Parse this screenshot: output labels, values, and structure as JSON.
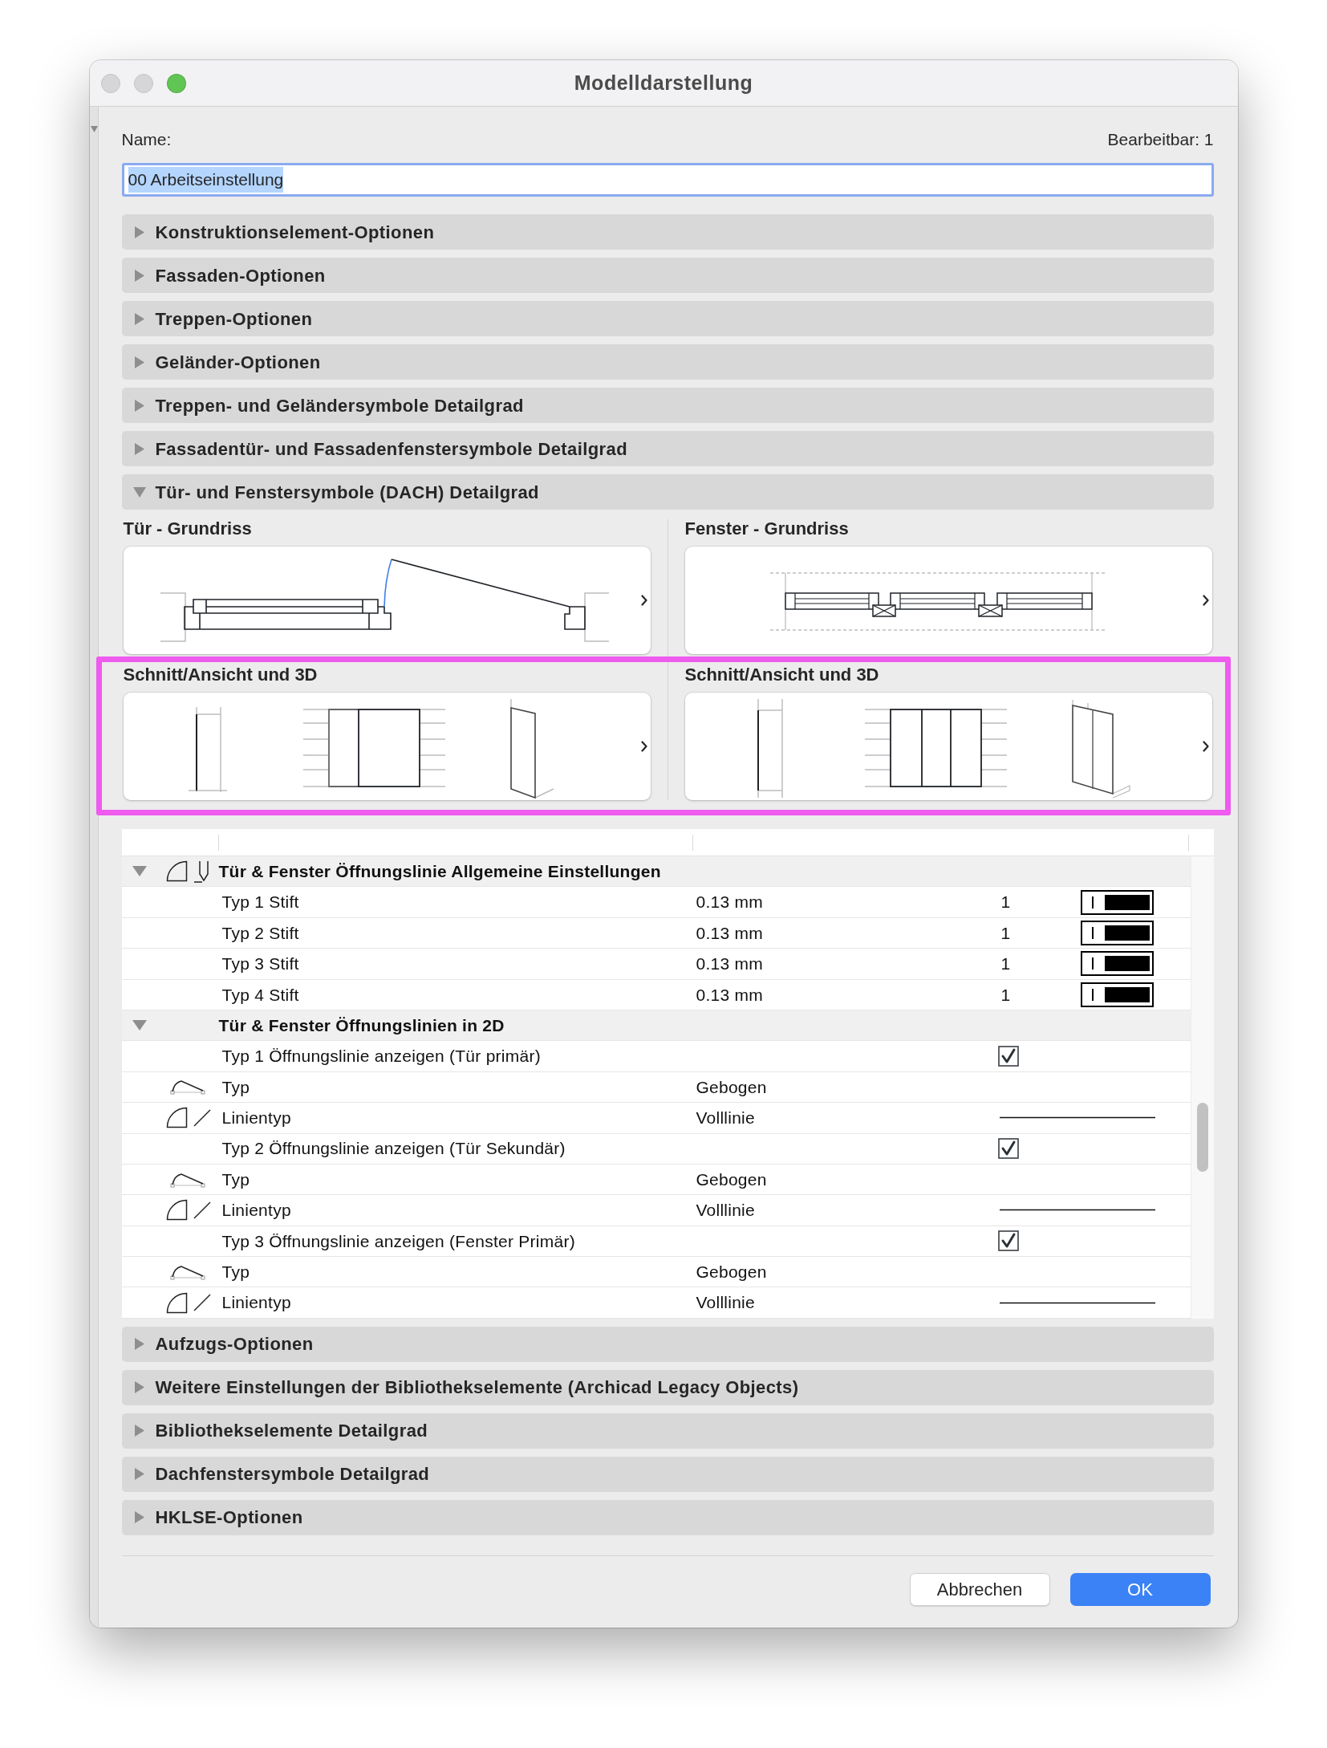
{
  "window": {
    "title": "Modelldarstellung",
    "controls": [
      {
        "kind": "close",
        "enabled": false
      },
      {
        "kind": "minimize",
        "enabled": false
      },
      {
        "kind": "zoom",
        "enabled": true
      }
    ]
  },
  "name_label": "Name:",
  "editable_count": "Bearbeitbar: 1",
  "name_field": {
    "value": "00 Arbeitseinstellung",
    "focused": true,
    "text_selected": true
  },
  "sections": [
    {
      "title": "Konstruktionselement-Optionen",
      "expanded": false
    },
    {
      "title": "Fassaden-Optionen",
      "expanded": false
    },
    {
      "title": "Treppen-Optionen",
      "expanded": false
    },
    {
      "title": "Geländer-Optionen",
      "expanded": false
    },
    {
      "title": "Treppen- und Geländersymbole Detailgrad",
      "expanded": false
    },
    {
      "title": "Fassadentür- und Fassadenfenstersymbole Detailgrad",
      "expanded": false
    },
    {
      "title": "Tür- und Fenstersymbole (DACH) Detailgrad",
      "expanded": true,
      "preview_rows": [
        {
          "highlighted": false,
          "items": [
            {
              "title": "Tür - Grundriss",
              "kind": "door-plan"
            },
            {
              "title": "Fenster - Grundriss",
              "kind": "window-plan"
            }
          ]
        },
        {
          "highlighted": true,
          "items": [
            {
              "title": "Schnitt/Ansicht und 3D",
              "kind": "door-views"
            },
            {
              "title": "Schnitt/Ansicht und 3D",
              "kind": "window-views"
            }
          ]
        }
      ],
      "table": {
        "rows": [
          {
            "kind": "pen-group",
            "label": "Tür & Fenster Öffnungslinie Allgemeine Einstellungen",
            "expanded": true,
            "children": [
              {
                "kind": "pen",
                "label": "Typ 1 Stift",
                "value": "0.13 mm",
                "number": "1"
              },
              {
                "kind": "pen",
                "label": "Typ 2 Stift",
                "value": "0.13 mm",
                "number": "1"
              },
              {
                "kind": "pen",
                "label": "Typ 3 Stift",
                "value": "0.13 mm",
                "number": "1"
              },
              {
                "kind": "pen",
                "label": "Typ 4 Stift",
                "value": "0.13 mm",
                "number": "1"
              }
            ]
          },
          {
            "kind": "group",
            "label": "Tür & Fenster Öffnungslinien in 2D",
            "expanded": true,
            "children": [
              {
                "kind": "checkbox",
                "label": "Typ 1 Öffnungslinie anzeigen (Tür primär)",
                "checked": true
              },
              {
                "kind": "curve",
                "label": "Typ",
                "value": "Gebogen"
              },
              {
                "kind": "linetype",
                "label": "Linientyp",
                "value": "Volllinie"
              },
              {
                "kind": "checkbox",
                "label": "Typ 2 Öffnungslinie anzeigen (Tür Sekundär)",
                "checked": true
              },
              {
                "kind": "curve",
                "label": "Typ",
                "value": "Gebogen"
              },
              {
                "kind": "linetype",
                "label": "Linientyp",
                "value": "Volllinie"
              },
              {
                "kind": "checkbox",
                "label": "Typ 3 Öffnungslinie anzeigen (Fenster Primär)",
                "checked": true
              },
              {
                "kind": "curve",
                "label": "Typ",
                "value": "Gebogen"
              },
              {
                "kind": "linetype",
                "label": "Linientyp",
                "value": "Volllinie"
              }
            ]
          }
        ]
      }
    },
    {
      "title": "Aufzugs-Optionen",
      "expanded": false
    },
    {
      "title": "Weitere Einstellungen der Bibliothekselemente (Archicad Legacy Objects)",
      "expanded": false
    },
    {
      "title": "Bibliothekselemente Detailgrad",
      "expanded": false
    },
    {
      "title": "Dachfenstersymbole Detailgrad",
      "expanded": false
    },
    {
      "title": "HKLSE-Optionen",
      "expanded": false
    }
  ],
  "buttons": [
    {
      "label": "Abbrechen",
      "kind": "cancel"
    },
    {
      "label": "OK",
      "kind": "default"
    }
  ]
}
